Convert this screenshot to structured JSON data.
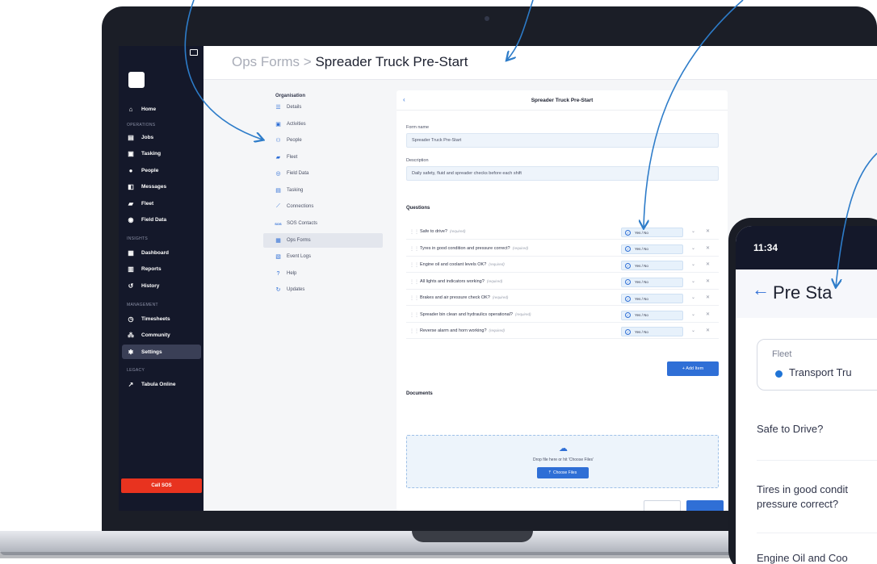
{
  "app": {
    "breadcrumb_root": "Ops Forms",
    "breadcrumb_sep": ">",
    "breadcrumb_current": "Spreader Truck Pre-Start"
  },
  "sidebar": {
    "sections": [
      "OPERATIONS",
      "INSIGHTS",
      "MANAGEMENT",
      "LEGACY"
    ],
    "items": [
      {
        "label": "Home",
        "icon": "home-icon"
      },
      {
        "label": "Jobs",
        "icon": "jobs-icon"
      },
      {
        "label": "Tasking",
        "icon": "tasking-icon"
      },
      {
        "label": "People",
        "icon": "person-icon"
      },
      {
        "label": "Messages",
        "icon": "messages-icon"
      },
      {
        "label": "Fleet",
        "icon": "truck-icon"
      },
      {
        "label": "Field Data",
        "icon": "location-pin-icon"
      },
      {
        "label": "Dashboard",
        "icon": "dashboard-icon"
      },
      {
        "label": "Reports",
        "icon": "reports-icon"
      },
      {
        "label": "History",
        "icon": "history-icon"
      },
      {
        "label": "Timesheets",
        "icon": "clock-icon"
      },
      {
        "label": "Community",
        "icon": "community-icon"
      },
      {
        "label": "Settings",
        "icon": "gear-icon"
      },
      {
        "label": "Tabula Online",
        "icon": "external-link-icon"
      }
    ],
    "sos_label": "Call SOS"
  },
  "settings_nav": {
    "title": "Organisation",
    "items": [
      {
        "label": "Details"
      },
      {
        "label": "Activities"
      },
      {
        "label": "People"
      },
      {
        "label": "Fleet"
      },
      {
        "label": "Field Data"
      },
      {
        "label": "Tasking"
      },
      {
        "label": "Connections"
      },
      {
        "label": "SOS Contacts"
      },
      {
        "label": "Ops Forms"
      },
      {
        "label": "Event Logs"
      },
      {
        "label": "Help"
      },
      {
        "label": "Updates"
      }
    ]
  },
  "form": {
    "title": "Spreader Truck Pre-Start",
    "form_name_label": "Form name",
    "form_name_value": "Spreader Truck Pre-Start",
    "description_label": "Description",
    "description_value": "Daily safety, fluid and spreader checks before each shift",
    "questions_label": "Questions",
    "required_tag": "(required)",
    "answer_type": "Yes / No",
    "questions": [
      "Safe to drive?",
      "Tyres in good condition and pressure correct?",
      "Engine oil and coolant levels OK?",
      "All lights and indicators working?",
      "Brakes and air pressure check OK?",
      "Spreader bin clean and hydraulics operational?",
      "Reverse alarm and horn working?"
    ],
    "add_item_label": "+ Add Item",
    "documents_label": "Documents",
    "drop_text": "Drop file here or hit 'Choose Files'",
    "choose_files_label": "Choose Files"
  },
  "phone": {
    "time": "11:34",
    "title": "Pre Sta",
    "fleet_label": "Fleet",
    "fleet_value": "Transport Tru",
    "questions": [
      "Safe to Drive?",
      "Tires in good condit",
      "pressure correct?",
      "Engine Oil and Coo"
    ]
  },
  "colors": {
    "sidebar_bg": "#14182a",
    "accent": "#2f6fd6",
    "sos": "#e8331f",
    "arrow": "#2d7cc9"
  }
}
